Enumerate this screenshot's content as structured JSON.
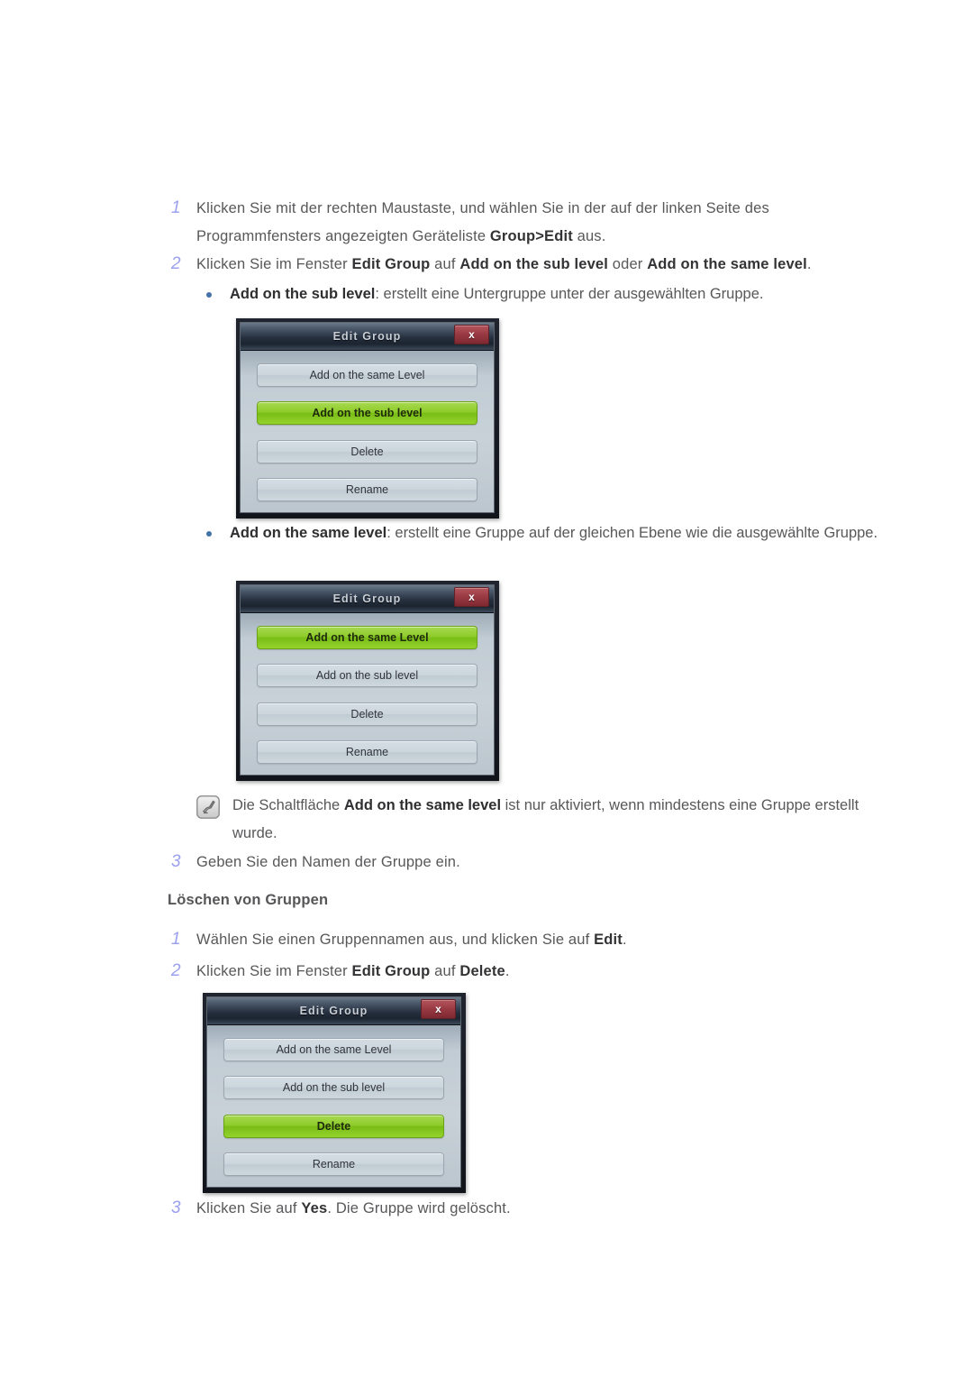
{
  "document": {
    "steps_group_create": [
      {
        "number": "1",
        "segments": [
          {
            "t": "Klicken Sie mit der rechten Maustaste, und wählen Sie in der auf der linken Seite des Programmfensters angezeigten Geräteliste ",
            "b": false
          },
          {
            "t": "Group>Edit",
            "b": true
          },
          {
            "t": " aus.",
            "b": false
          }
        ]
      },
      {
        "number": "2",
        "segments": [
          {
            "t": "Klicken Sie im Fenster ",
            "b": false
          },
          {
            "t": "Edit Group",
            "b": true
          },
          {
            "t": " auf ",
            "b": false
          },
          {
            "t": "Add on the sub level",
            "b": true
          },
          {
            "t": " oder ",
            "b": false
          },
          {
            "t": "Add on the same level",
            "b": true
          },
          {
            "t": ".",
            "b": false
          }
        ]
      },
      {
        "number": "3",
        "segments": [
          {
            "t": "Geben Sie den Namen der Gruppe ein.",
            "b": false
          }
        ]
      }
    ],
    "bullet_sub_level": [
      {
        "t": "Add on the sub level",
        "b": true
      },
      {
        "t": ": erstellt eine Untergruppe unter der ausgewählten Gruppe.",
        "b": false
      }
    ],
    "bullet_same_level": [
      {
        "t": "Add on the same level",
        "b": true
      },
      {
        "t": ": erstellt eine Gruppe auf der gleichen Ebene wie die ausgewählte Gruppe.",
        "b": false
      }
    ],
    "note": {
      "icon": "note-pencil-icon",
      "segments": [
        {
          "t": "Die Schaltfläche ",
          "b": false
        },
        {
          "t": "Add on the same level",
          "b": true
        },
        {
          "t": " ist nur aktiviert, wenn mindestens eine Gruppe erstellt wurde.",
          "b": false
        }
      ]
    },
    "section_heading_delete": "Löschen von Gruppen",
    "steps_group_delete": [
      {
        "number": "1",
        "segments": [
          {
            "t": "Wählen Sie einen Gruppennamen aus, und klicken Sie auf ",
            "b": false
          },
          {
            "t": "Edit",
            "b": true
          },
          {
            "t": ".",
            "b": false
          }
        ]
      },
      {
        "number": "2",
        "segments": [
          {
            "t": "Klicken Sie im Fenster ",
            "b": false
          },
          {
            "t": "Edit Group",
            "b": true
          },
          {
            "t": " auf ",
            "b": false
          },
          {
            "t": "Delete",
            "b": true
          },
          {
            "t": ".",
            "b": false
          }
        ]
      },
      {
        "number": "3",
        "segments": [
          {
            "t": "Klicken Sie auf ",
            "b": false
          },
          {
            "t": "Yes",
            "b": true
          },
          {
            "t": ". Die Gruppe wird gelöscht.",
            "b": false
          }
        ]
      }
    ]
  },
  "dialogs": [
    {
      "id": "dialog-sub-level",
      "title": "Edit Group",
      "close_label": "x",
      "buttons": [
        {
          "label": "Add on the same Level",
          "selected": false
        },
        {
          "label": "Add on the sub level",
          "selected": true
        },
        {
          "label": "Delete",
          "selected": false
        },
        {
          "label": "Rename",
          "selected": false
        }
      ]
    },
    {
      "id": "dialog-same-level",
      "title": "Edit Group",
      "close_label": "x",
      "buttons": [
        {
          "label": "Add on the same Level",
          "selected": true
        },
        {
          "label": "Add on the sub level",
          "selected": false
        },
        {
          "label": "Delete",
          "selected": false
        },
        {
          "label": "Rename",
          "selected": false
        }
      ]
    },
    {
      "id": "dialog-delete",
      "title": "Edit Group",
      "close_label": "x",
      "buttons": [
        {
          "label": "Add on the same Level",
          "selected": false
        },
        {
          "label": "Add on the sub level",
          "selected": false
        },
        {
          "label": "Delete",
          "selected": true
        },
        {
          "label": "Rename",
          "selected": false
        }
      ]
    }
  ],
  "colors": {
    "number_blue": "#9ba0ef",
    "bullet_blue": "#4472a8",
    "body_text": "#58585a",
    "selected_green": "#8ecc2a",
    "close_red": "#9b3b44",
    "titlebar_dark": "#26303f"
  }
}
